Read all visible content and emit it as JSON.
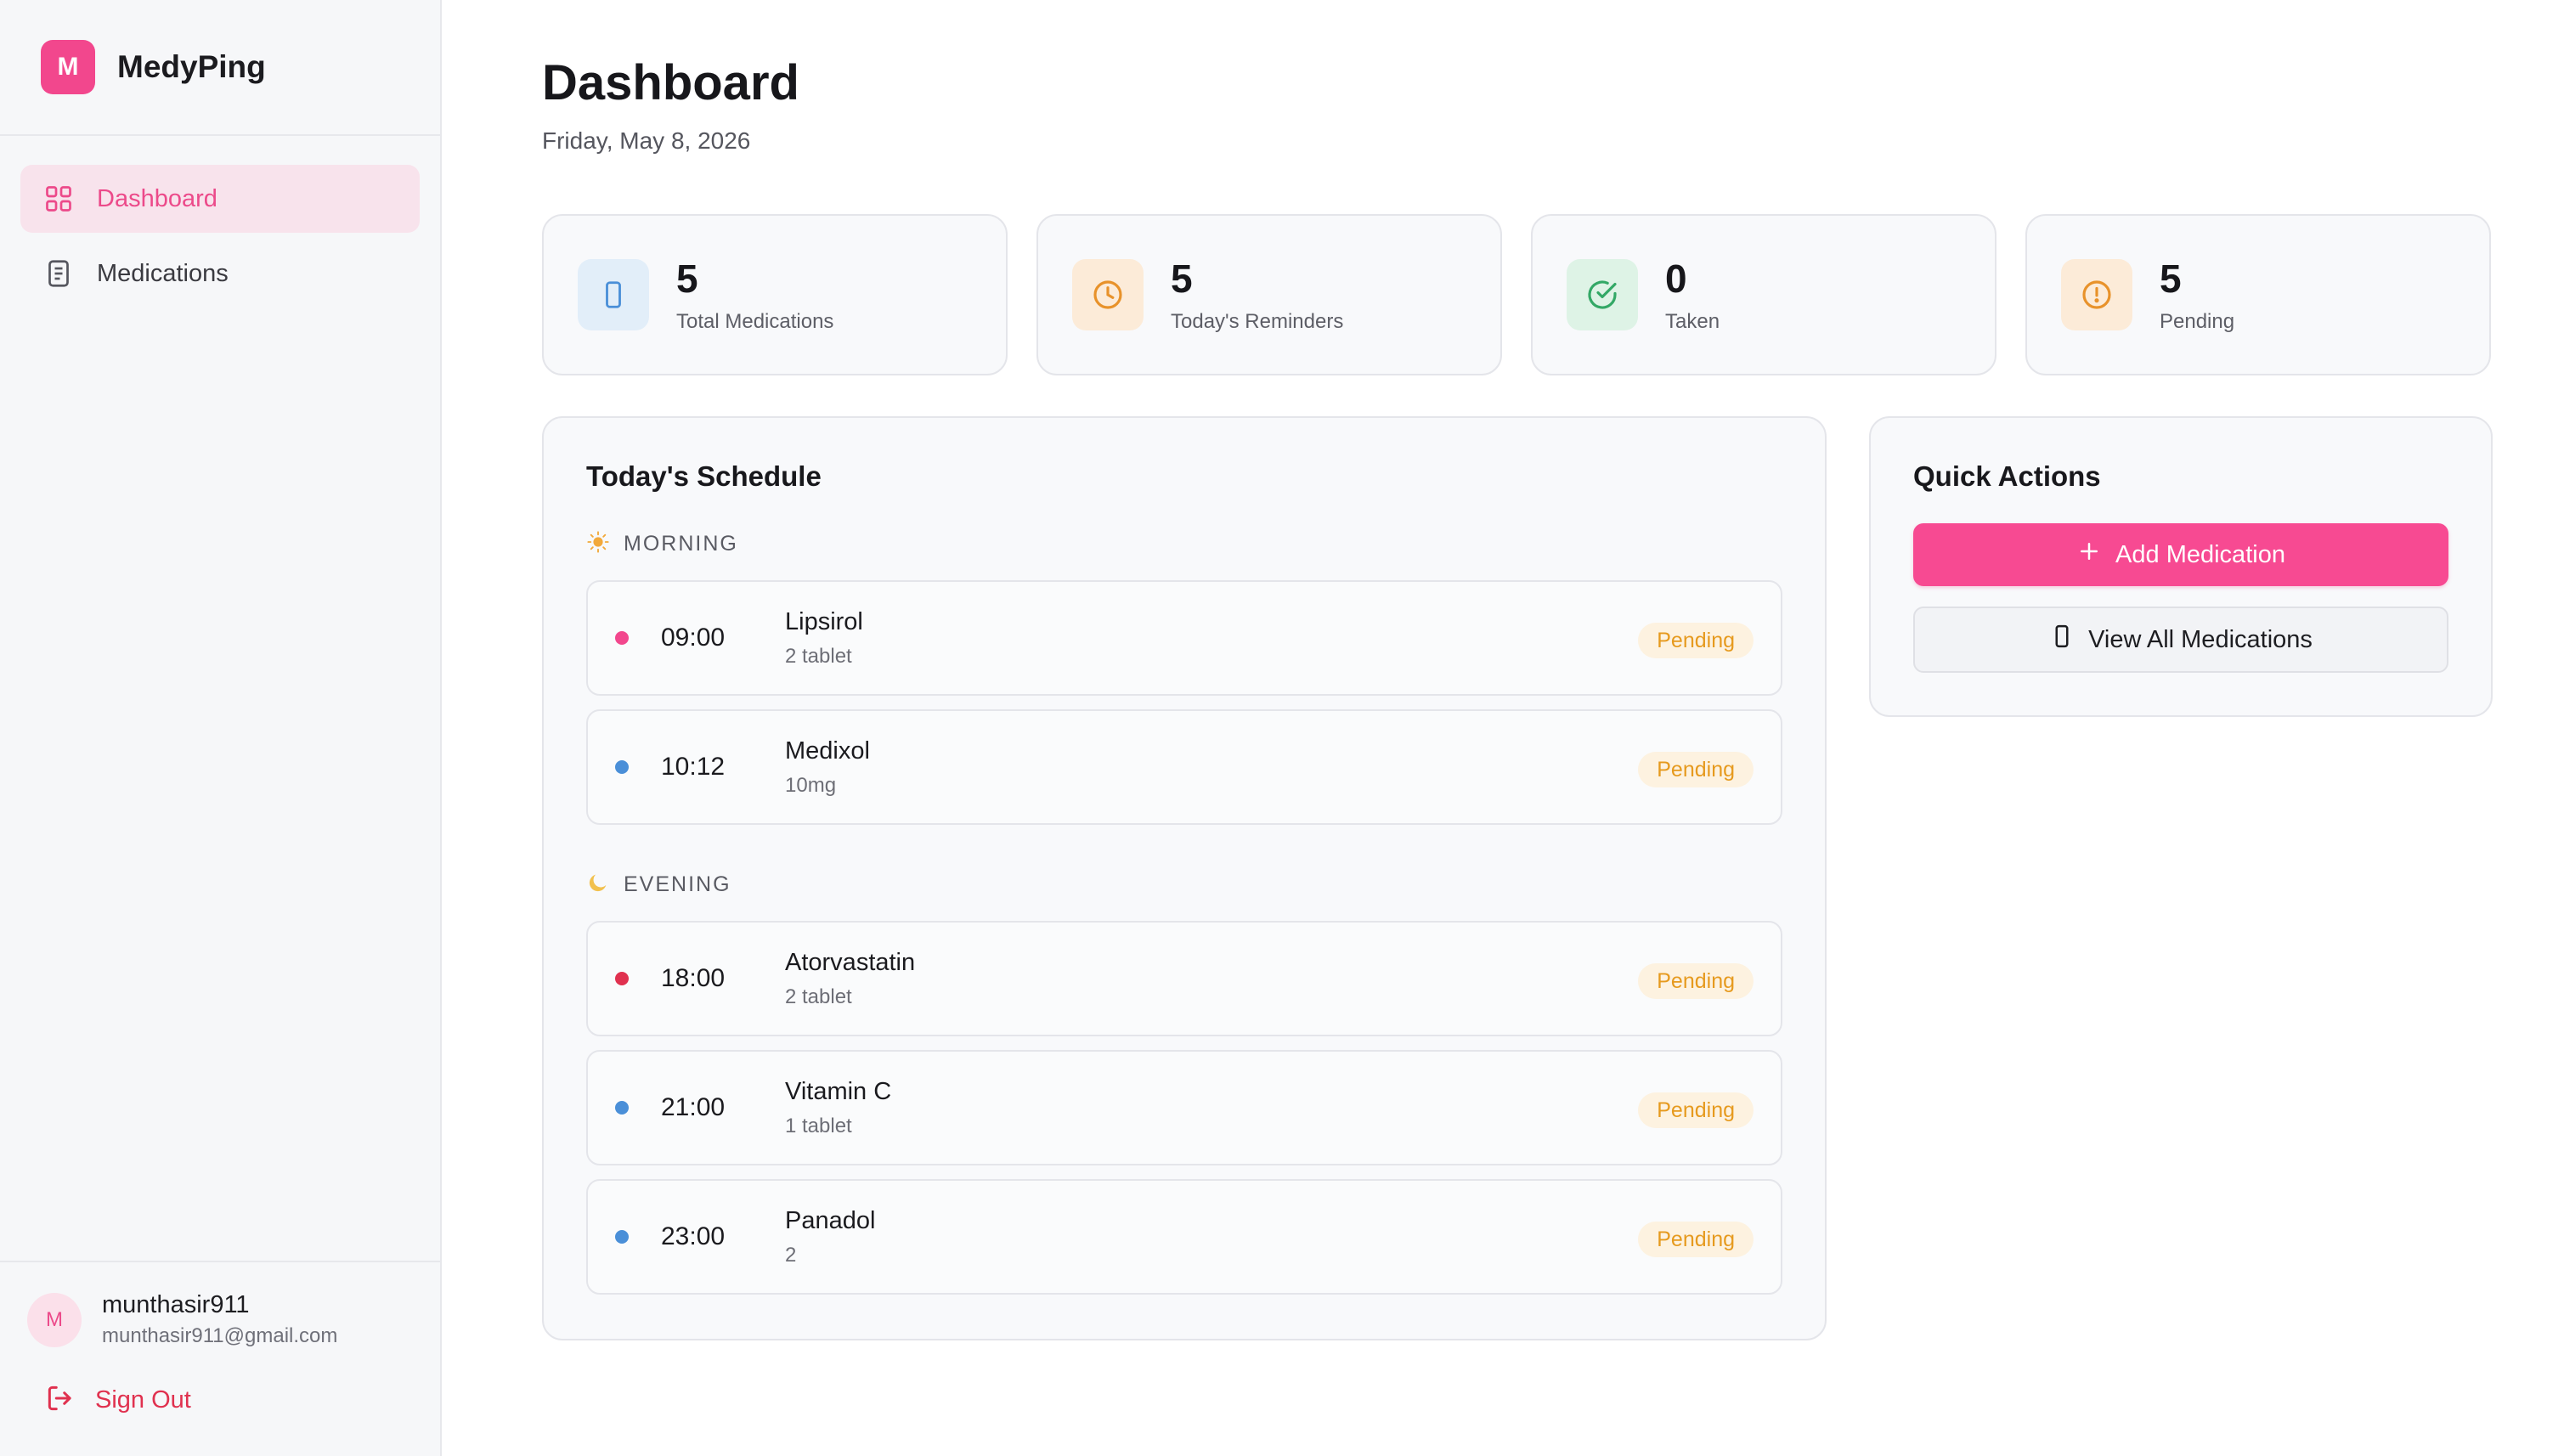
{
  "brand": {
    "logo_letter": "M",
    "name": "MedyPing",
    "accent": "#f2478d"
  },
  "nav": {
    "items": [
      {
        "label": "Dashboard",
        "icon": "grid-icon",
        "active": true
      },
      {
        "label": "Medications",
        "icon": "clipboard-icon",
        "active": false
      }
    ]
  },
  "user": {
    "avatar_letter": "M",
    "name": "munthasir911",
    "email": "munthasir911@gmail.com"
  },
  "signout": {
    "label": "Sign Out"
  },
  "header": {
    "title": "Dashboard",
    "date": "Friday, May 8, 2026"
  },
  "stats": [
    {
      "value": "5",
      "label": "Total Medications",
      "icon": "phone-icon",
      "color": "#4a8fd8"
    },
    {
      "value": "5",
      "label": "Today's Reminders",
      "icon": "clock-icon",
      "color": "#e8922a"
    },
    {
      "value": "0",
      "label": "Taken",
      "icon": "check-circle-icon",
      "color": "#33a866"
    },
    {
      "value": "5",
      "label": "Pending",
      "icon": "alert-circle-icon",
      "color": "#e8922a"
    }
  ],
  "schedule": {
    "title": "Today's Schedule",
    "morning": {
      "label": "MORNING",
      "icon": "sun-icon",
      "items": [
        {
          "time": "09:00",
          "name": "Lipsirol",
          "dose": "2 tablet",
          "status": "Pending",
          "dot_color": "#f2478d"
        },
        {
          "time": "10:12",
          "name": "Medixol",
          "dose": "10mg",
          "status": "Pending",
          "dot_color": "#4a8fd8"
        }
      ]
    },
    "evening": {
      "label": "EVENING",
      "icon": "moon-icon",
      "items": [
        {
          "time": "18:00",
          "name": "Atorvastatin",
          "dose": "2 tablet",
          "status": "Pending",
          "dot_color": "#e0314f"
        },
        {
          "time": "21:00",
          "name": "Vitamin C",
          "dose": "1 tablet",
          "status": "Pending",
          "dot_color": "#4a8fd8"
        },
        {
          "time": "23:00",
          "name": "Panadol",
          "dose": "2",
          "status": "Pending",
          "dot_color": "#4a8fd8"
        }
      ]
    }
  },
  "quick_actions": {
    "title": "Quick Actions",
    "add_label": "Add Medication",
    "view_label": "View All Medications"
  }
}
